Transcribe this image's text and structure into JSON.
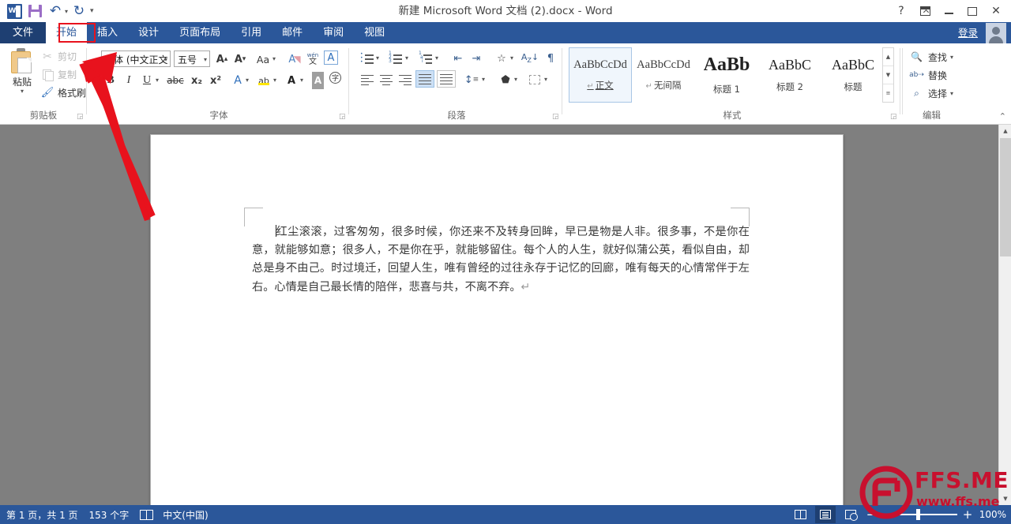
{
  "window": {
    "title": "新建 Microsoft Word 文档 (2).docx - Word",
    "help_label": "?",
    "ribbon_display_label": "ribbon-display-options",
    "minimize_label": "minimize",
    "restore_label": "restore",
    "close_label": "✕"
  },
  "quick_access": {
    "app_logo": "word-logo",
    "save_label": "save-icon",
    "undo_label": "↶",
    "redo_label": "↻",
    "customize_label": "▾"
  },
  "tabs": {
    "file": "文件",
    "items": [
      {
        "label": "开始",
        "active": true
      },
      {
        "label": "插入",
        "active": false
      },
      {
        "label": "设计",
        "active": false
      },
      {
        "label": "页面布局",
        "active": false
      },
      {
        "label": "引用",
        "active": false
      },
      {
        "label": "邮件",
        "active": false
      },
      {
        "label": "审阅",
        "active": false
      },
      {
        "label": "视图",
        "active": false
      }
    ],
    "signin": "登录"
  },
  "ribbon": {
    "clipboard": {
      "group_label": "剪贴板",
      "paste_label": "粘贴",
      "paste_caret": "▾",
      "cut_label": "剪切",
      "copy_label": "复制",
      "format_painter_label": "格式刷",
      "dialog_launcher": "⌐"
    },
    "font": {
      "group_label": "字体",
      "font_name_value": "宋体 (中文正文",
      "font_size_value": "五号",
      "grow_font": "A",
      "shrink_font": "A",
      "change_case": "Aa",
      "clear_format": "clear-formatting-icon",
      "phonetic_guide": "wén",
      "char_border": "A",
      "bold": "B",
      "italic": "I",
      "underline": "U",
      "strikethrough": "abc",
      "subscript": "x₂",
      "superscript": "x²",
      "text_effects": "A",
      "highlight": "ab",
      "font_color": "A",
      "char_shading": "A",
      "enclose_char": "字",
      "dialog_launcher": "⌐"
    },
    "paragraph": {
      "group_label": "段落",
      "bullets": "bullet-list-icon",
      "numbering": "numbered-list-icon",
      "multilevel": "multilevel-list-icon",
      "decrease_indent": "decrease-indent-icon",
      "increase_indent": "increase-indent-icon",
      "sort": "sort-icon",
      "asian_sort": "asian-layout-icon",
      "show_marks": "show-paragraph-marks-icon",
      "align_left": "align-left-icon",
      "align_center": "align-center-icon",
      "align_right": "align-right-icon",
      "justify": "justify-icon",
      "distribute": "distribute-icon",
      "line_spacing": "line-spacing-icon",
      "shading": "shading-icon",
      "borders": "borders-icon",
      "dialog_launcher": "⌐"
    },
    "styles": {
      "group_label": "样式",
      "gallery": [
        {
          "sample": "AaBbCcDd",
          "name": "正文",
          "pilcrow": "↵",
          "selected": true,
          "kind": "body"
        },
        {
          "sample": "AaBbCcDd",
          "name": "无间隔",
          "pilcrow": "↵",
          "selected": false,
          "kind": "body"
        },
        {
          "sample": "AaBb",
          "name": "标题 1",
          "pilcrow": "",
          "selected": false,
          "kind": "h1"
        },
        {
          "sample": "AaBbC",
          "name": "标题 2",
          "pilcrow": "",
          "selected": false,
          "kind": "h2"
        },
        {
          "sample": "AaBbC",
          "name": "标题",
          "pilcrow": "",
          "selected": false,
          "kind": "h3"
        }
      ],
      "scroll_up": "▲",
      "scroll_down": "▼",
      "more": "▾",
      "dialog_launcher": "⌐"
    },
    "editing": {
      "group_label": "编辑",
      "find_label": "查找",
      "find_caret": "▾",
      "replace_label": "替换",
      "select_label": "选择",
      "select_caret": "▾",
      "collapse_ribbon": "⌃"
    }
  },
  "document": {
    "paragraph": "红尘滚滚，过客匆匆，很多时候，你还来不及转身回眸，早已是物是人非。很多事，不是你在意，就能够如意；很多人，不是你在乎，就能够留住。每个人的人生，就好似蒲公英，看似自由，却总是身不由己。时过境迁，回望人生，唯有曾经的过往永存于记忆的回廊，唯有每天的心情常伴于左右。心情是自己最长情的陪伴，悲喜与共，不离不弃。",
    "end_mark": "↵"
  },
  "statusbar": {
    "page_info": "第 1 页，共 1 页",
    "word_count": "153 个字",
    "proofing_icon": "proofing-icon",
    "language": "中文(中国)",
    "read_mode": "read-mode-icon",
    "print_layout": "print-layout-icon",
    "web_layout": "web-layout-icon",
    "zoom_out": "−",
    "zoom_in": "+",
    "zoom_level": "100%"
  },
  "annotations": {
    "highlight_color": "#e8121d",
    "arrow_color": "#e8121d",
    "target": "开始"
  },
  "watermark": {
    "brand": "FFS.ME",
    "url": "www.ffs.me",
    "color": "#c8102e"
  }
}
